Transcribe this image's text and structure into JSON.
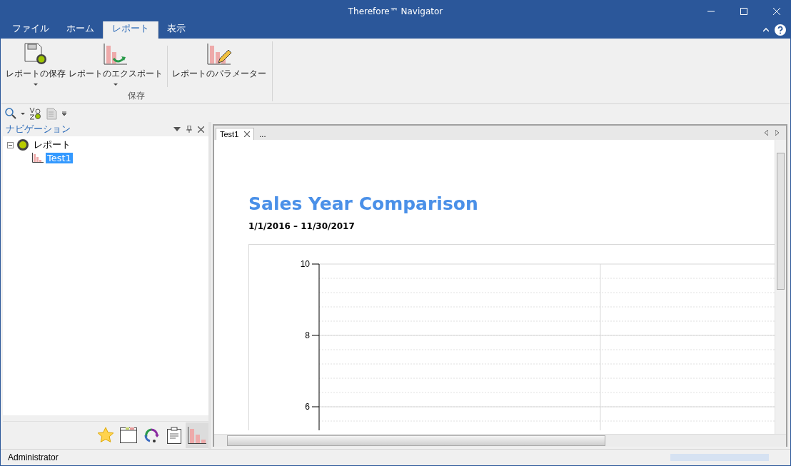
{
  "window": {
    "title": "Therefore™ Navigator"
  },
  "menu_tabs": [
    {
      "label": "ファイル",
      "selected": false
    },
    {
      "label": "ホーム",
      "selected": false
    },
    {
      "label": "レポート",
      "selected": true
    },
    {
      "label": "表示",
      "selected": false
    }
  ],
  "ribbon": {
    "groups": [
      {
        "label": "保存",
        "buttons": [
          {
            "label": "レポートの保存",
            "kind": "save",
            "dropdown": true
          },
          {
            "label": "レポートのエクスポート",
            "kind": "export",
            "dropdown": true
          },
          {
            "label": "レポートのパラメーター",
            "kind": "parameters",
            "dropdown": false
          }
        ]
      }
    ]
  },
  "navigation": {
    "title": "ナビゲーション",
    "tree": [
      {
        "label": "レポート",
        "selected": false,
        "expanded": true,
        "children": [
          {
            "label": "Test1",
            "selected": true
          }
        ]
      }
    ],
    "bottom_buttons": [
      {
        "kind": "star",
        "selected": false
      },
      {
        "kind": "window",
        "selected": false
      },
      {
        "kind": "workflow",
        "selected": false
      },
      {
        "kind": "clipboard",
        "selected": false
      },
      {
        "kind": "chart",
        "selected": true
      }
    ]
  },
  "document": {
    "tabs": [
      {
        "label": "Test1",
        "selected": true
      },
      {
        "label": "...",
        "selected": false
      }
    ],
    "report": {
      "title": "Sales Year Comparison",
      "date_range": "1/1/2016 – 11/30/2017",
      "y_ticks": [
        "10",
        "8",
        "6"
      ]
    }
  },
  "status_bar": {
    "user": "Administrator",
    "progress": {
      "level": 0
    }
  }
}
